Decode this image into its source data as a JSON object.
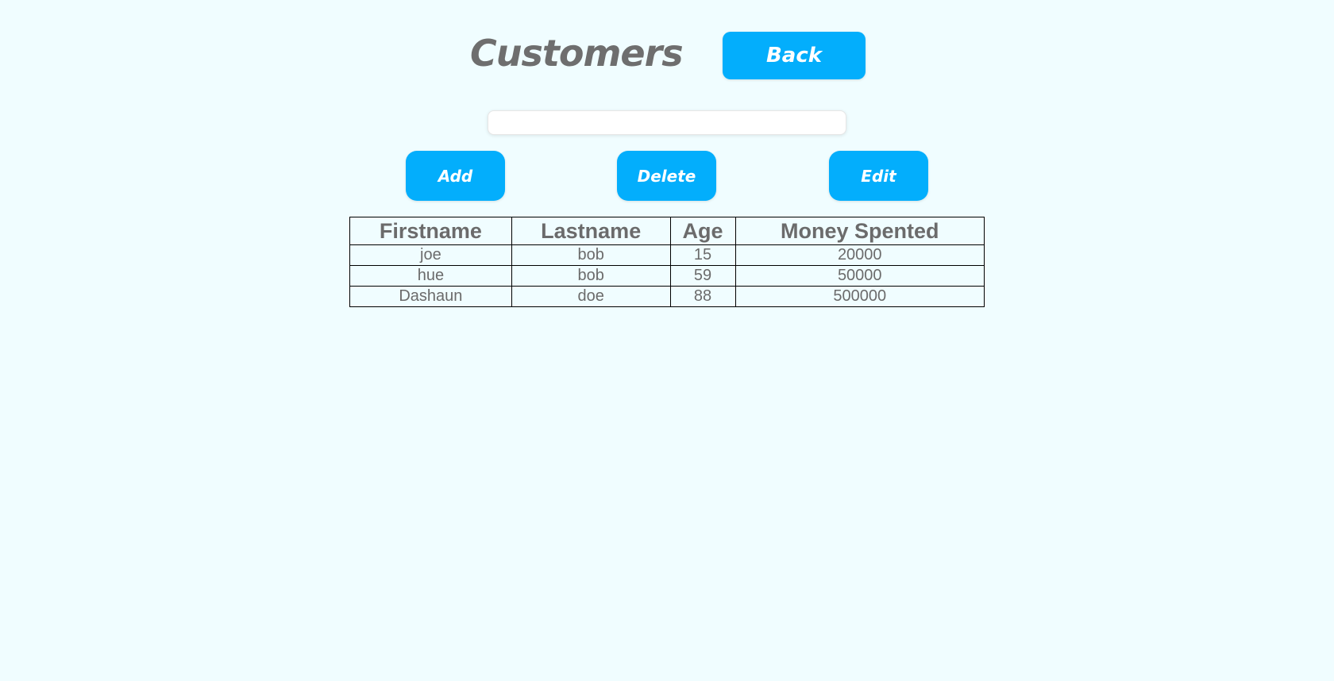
{
  "header": {
    "title": "Customers",
    "back_label": "Back"
  },
  "search": {
    "value": "",
    "placeholder": ""
  },
  "actions": {
    "add_label": "Add",
    "delete_label": "Delete",
    "edit_label": "Edit"
  },
  "table": {
    "columns": [
      "Firstname",
      "Lastname",
      "Age",
      "Money Spented"
    ],
    "rows": [
      [
        "joe",
        "bob",
        "15",
        "20000"
      ],
      [
        "hue",
        "bob",
        "59",
        "50000"
      ],
      [
        "Dashaun",
        "doe",
        "88",
        "500000"
      ]
    ]
  },
  "colors": {
    "background": "#f0fdff",
    "accent": "#03aefc",
    "text": "#6b6b6b"
  }
}
